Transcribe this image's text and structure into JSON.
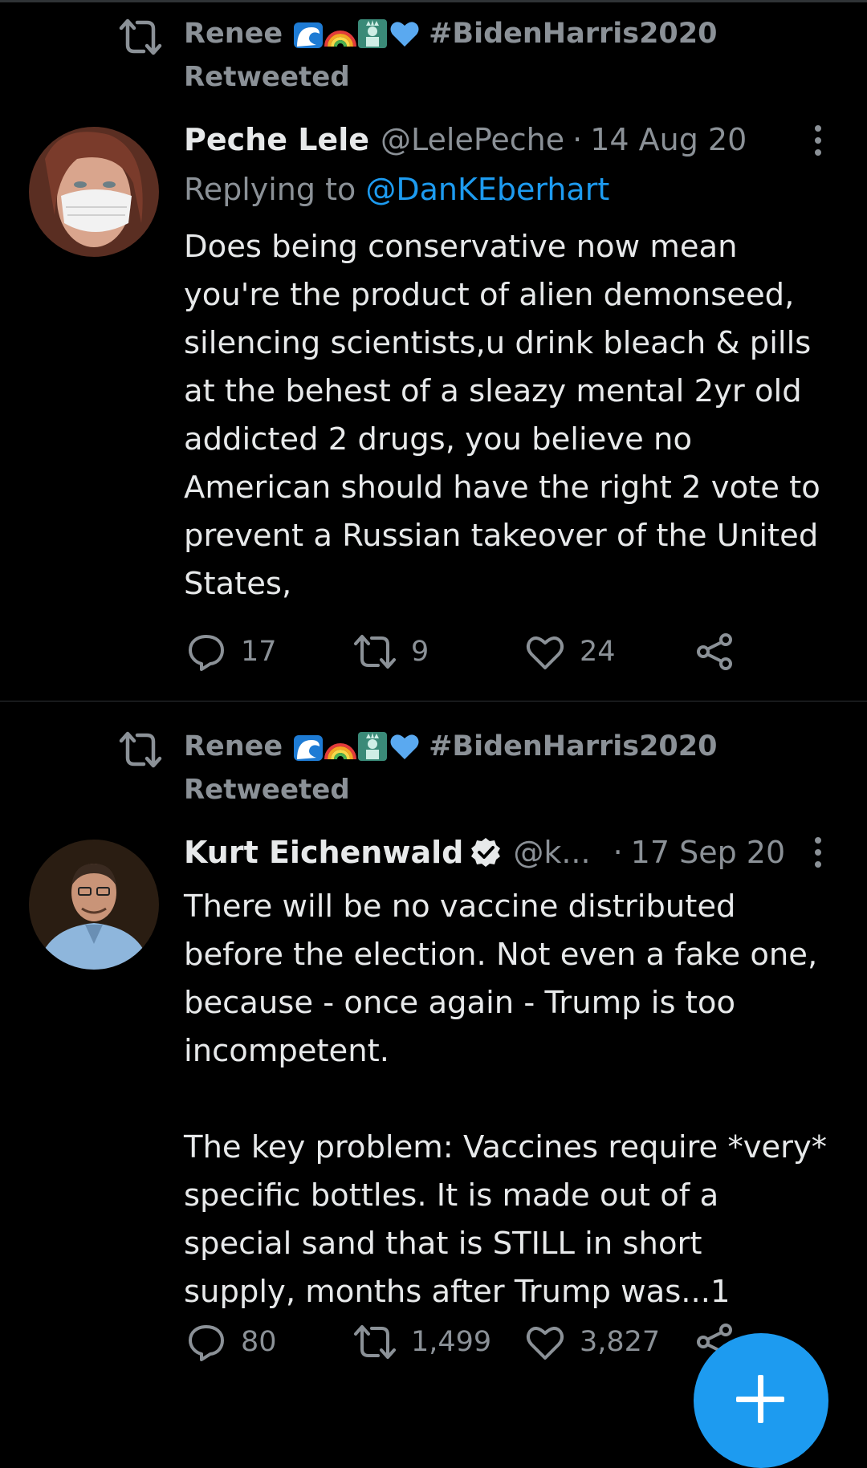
{
  "colors": {
    "background": "#000000",
    "text": "#e7e9ea",
    "muted": "#8b9197",
    "accent": "#1d9bf0",
    "divider": "#2f3336"
  },
  "tweets": [
    {
      "retweeter": "Renee",
      "retweeter_emojis": [
        "water-wave-icon",
        "rainbow-icon",
        "statue-of-liberty-icon",
        "blue-heart-icon"
      ],
      "retweeter_hashtag": "#BidenHarris2020",
      "retweeted_label": "Retweeted",
      "author_name": "Peche Lele",
      "author_handle": "@LelePeche",
      "separator": "·",
      "date": "14 Aug 20",
      "reply_prefix": "Replying to ",
      "reply_to": "@DanKEberhart",
      "text": "Does being conservative now mean\nyou're the product of alien demonseed,\nsilencing scientists,u drink bleach & pills\nat the behest of a sleazy mental 2yr old\naddicted 2 drugs, you believe no\nAmerican should have the right 2 vote to\nprevent a Russian takeover of the United\nStates,",
      "replies": "17",
      "retweets": "9",
      "likes": "24"
    },
    {
      "retweeter": "Renee",
      "retweeter_emojis": [
        "water-wave-icon",
        "rainbow-icon",
        "statue-of-liberty-icon",
        "blue-heart-icon"
      ],
      "retweeter_hashtag": "#BidenHarris2020",
      "retweeted_label": "Retweeted",
      "author_name": "Kurt Eichenwald",
      "author_verified": true,
      "author_handle": "@k...",
      "separator": "·",
      "date": "17 Sep 20",
      "text": "There will be no vaccine distributed\nbefore the election. Not even a fake one,\nbecause - once again - Trump is too\nincompetent.\n\nThe key problem: Vaccines require *very*\nspecific bottles. It is made out of a\nspecial sand that is STILL in short\nsupply, months after Trump was...1",
      "replies": "80",
      "retweets": "1,499",
      "likes": "3,827"
    }
  ],
  "fab": {
    "icon": "plus-icon"
  }
}
